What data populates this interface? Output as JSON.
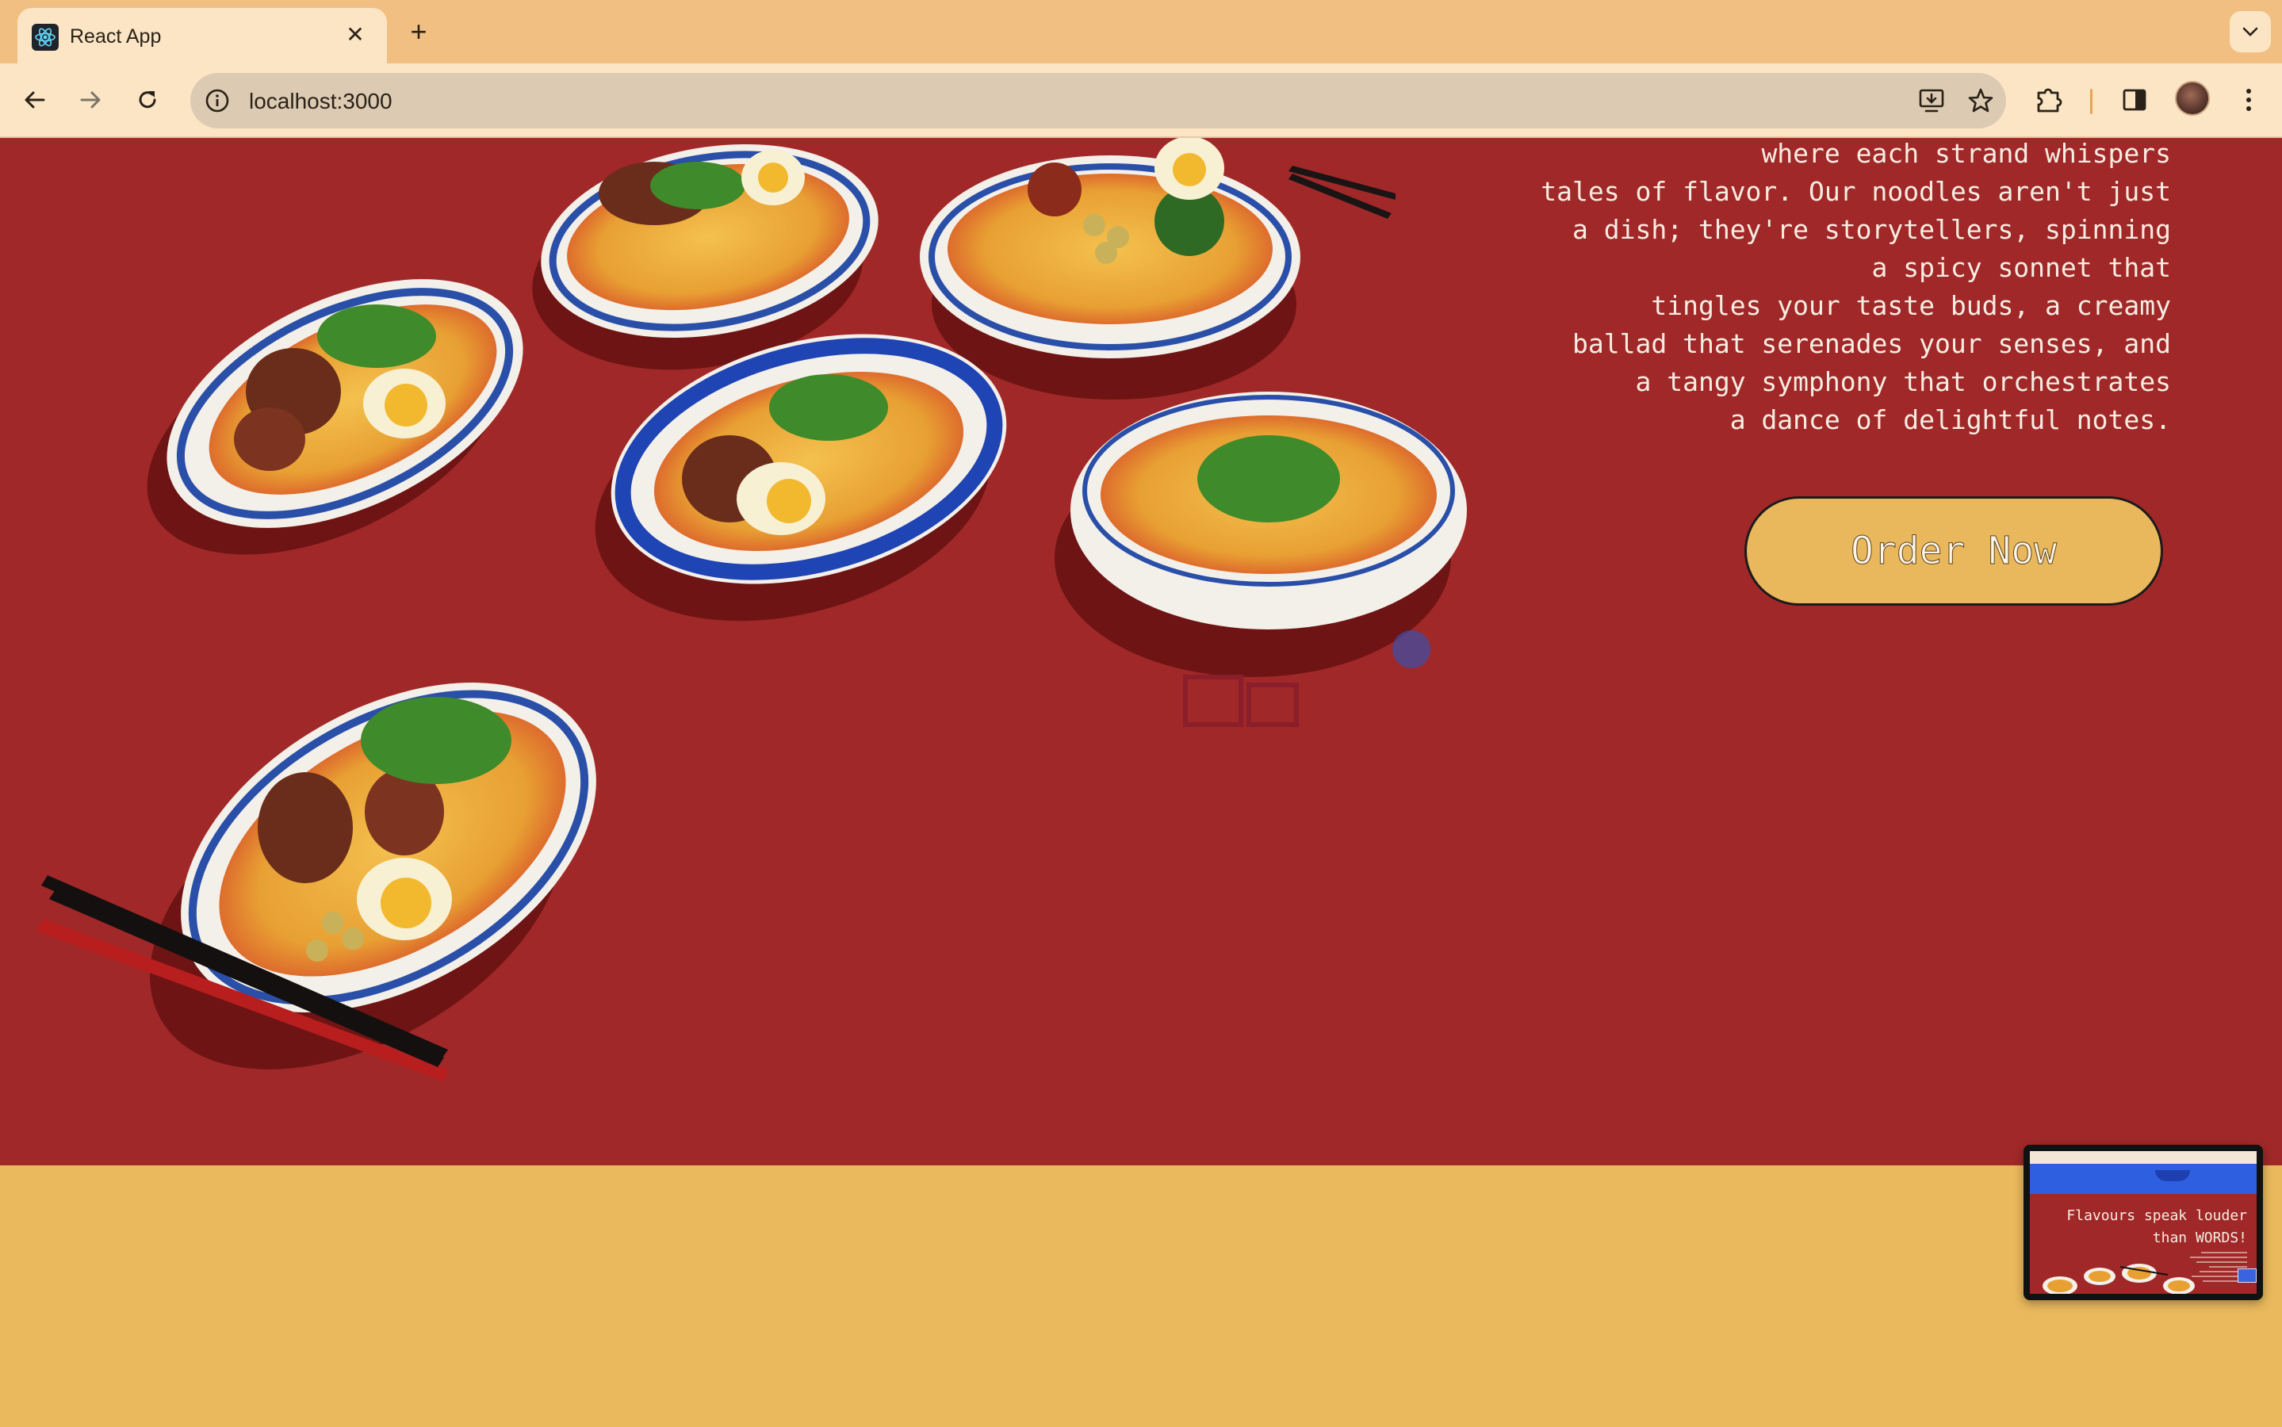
{
  "browser": {
    "tab": {
      "title": "React App",
      "favicon": "react-logo-icon"
    },
    "address": {
      "url": "localhost:3000"
    },
    "icons": [
      "back-arrow-icon",
      "forward-arrow-icon",
      "reload-icon",
      "site-info-icon",
      "install-app-icon",
      "bookmark-star-icon",
      "extensions-puzzle-icon",
      "side-panel-icon",
      "profile-avatar",
      "more-menu-icon",
      "tab-search-chevron-icon",
      "new-tab-plus-icon",
      "close-icon"
    ]
  },
  "hero": {
    "blurb_lines": [
      "where each strand whispers",
      "tales of flavor. Our noodles aren't just",
      "a dish; they're storytellers, spinning",
      "a spicy sonnet that",
      "tingles your taste buds, a creamy",
      "ballad that serenades your senses, and",
      "a tangy symphony that orchestrates",
      "a dance of delightful notes."
    ],
    "cta_label": "Order Now"
  },
  "pip_preview": {
    "headline_lines": [
      "Flavours speak louder",
      "than WORDS!"
    ]
  },
  "colors": {
    "hero_background": "#a12828",
    "band_background": "#eab95d",
    "cta_background": "#e9b75c",
    "tab_strip": "#f1bf82",
    "toolbar": "#fce5c5"
  }
}
